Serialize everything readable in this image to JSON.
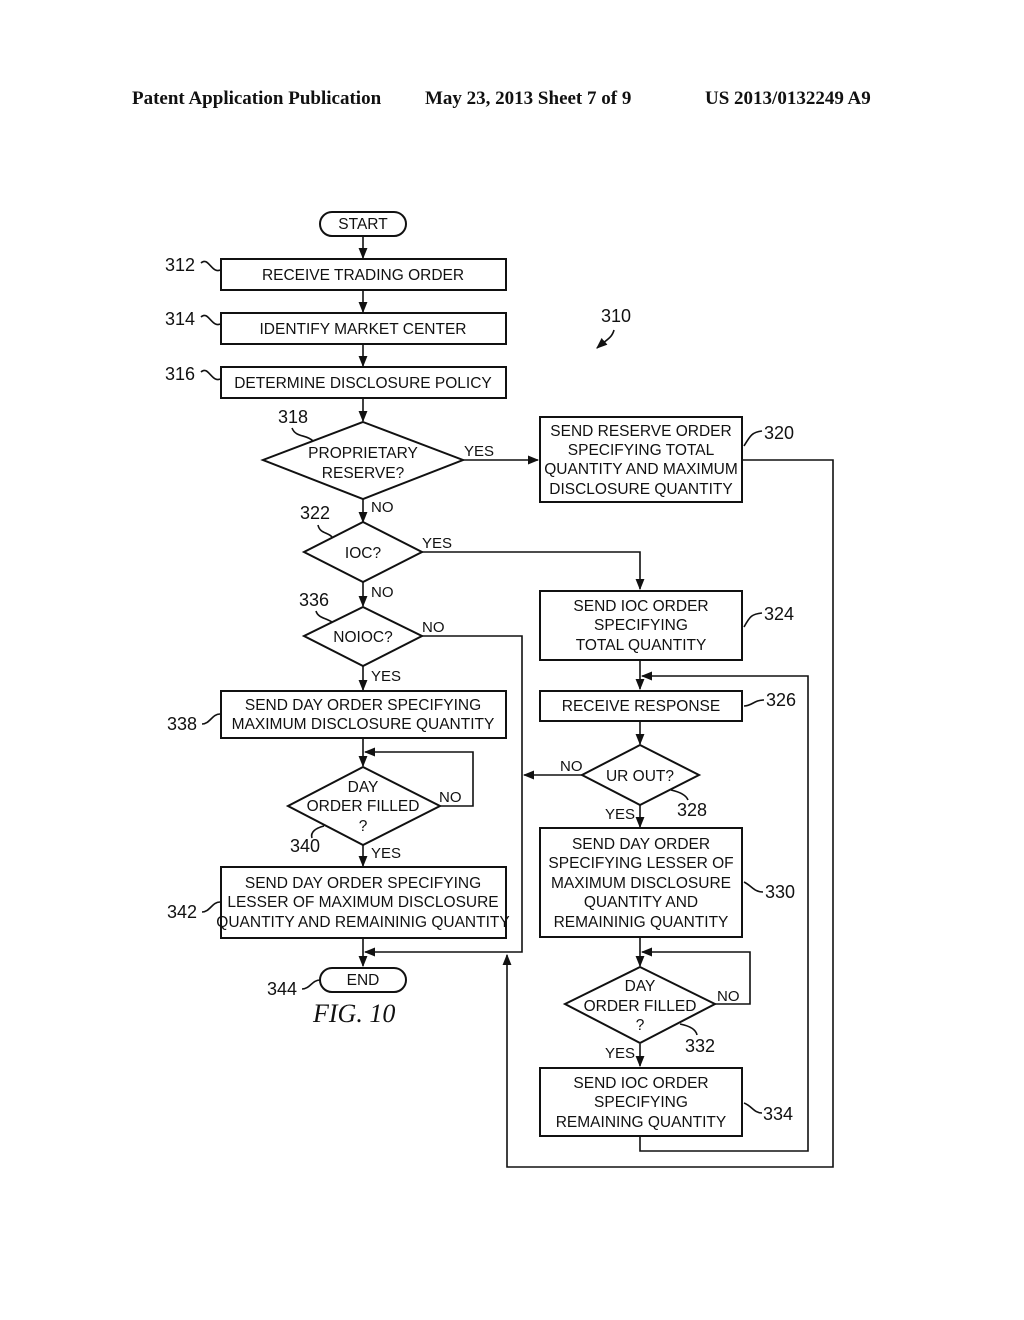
{
  "header": {
    "publication": "Patent Application Publication",
    "date_sheet": "May 23, 2013  Sheet 7 of 9",
    "number": "US 2013/0132249 A9"
  },
  "figure": {
    "label": "FIG. 10",
    "ref": "310"
  },
  "nodes": {
    "start": {
      "text": [
        "START"
      ]
    },
    "n312": {
      "ref": "312",
      "text": [
        "RECEIVE TRADING ORDER"
      ]
    },
    "n314": {
      "ref": "314",
      "text": [
        "IDENTIFY MARKET CENTER"
      ]
    },
    "n316": {
      "ref": "316",
      "text": [
        "DETERMINE DISCLOSURE POLICY"
      ]
    },
    "n318": {
      "ref": "318",
      "text": [
        "PROPRIETARY",
        "RESERVE?"
      ]
    },
    "n320": {
      "ref": "320",
      "text": [
        "SEND RESERVE ORDER",
        "SPECIFYING TOTAL",
        "QUANTITY AND MAXIMUM",
        "DISCLOSURE QUANTITY"
      ]
    },
    "n322": {
      "ref": "322",
      "text": [
        "IOC?"
      ]
    },
    "n324": {
      "ref": "324",
      "text": [
        "SEND IOC ORDER",
        "SPECIFYING",
        "TOTAL QUANTITY"
      ]
    },
    "n326": {
      "ref": "326",
      "text": [
        "RECEIVE RESPONSE"
      ]
    },
    "n328": {
      "ref": "328",
      "text": [
        "UR OUT?"
      ]
    },
    "n330": {
      "ref": "330",
      "text": [
        "SEND DAY ORDER",
        "SPECIFYING LESSER OF",
        "MAXIMUM DISCLOSURE",
        "QUANTITY AND",
        "REMAININIG QUANTITY"
      ]
    },
    "n332": {
      "ref": "332",
      "text": [
        "DAY",
        "ORDER FILLED",
        "?"
      ]
    },
    "n334": {
      "ref": "334",
      "text": [
        "SEND IOC ORDER",
        "SPECIFYING",
        "REMAINING QUANTITY"
      ]
    },
    "n336": {
      "ref": "336",
      "text": [
        "NOIOC?"
      ]
    },
    "n338": {
      "ref": "338",
      "text": [
        "SEND DAY ORDER SPECIFYING",
        "MAXIMUM DISCLOSURE QUANTITY"
      ]
    },
    "n340": {
      "ref": "340",
      "text": [
        "DAY",
        "ORDER FILLED",
        "?"
      ]
    },
    "n342": {
      "ref": "342",
      "text": [
        "SEND DAY ORDER SPECIFYING",
        "LESSER OF MAXIMUM DISCLOSURE",
        "QUANTITY AND REMAININIG QUANTITY"
      ]
    },
    "end": {
      "ref": "344",
      "text": [
        "END"
      ]
    }
  },
  "edge_labels": {
    "yes": "YES",
    "no": "NO"
  }
}
